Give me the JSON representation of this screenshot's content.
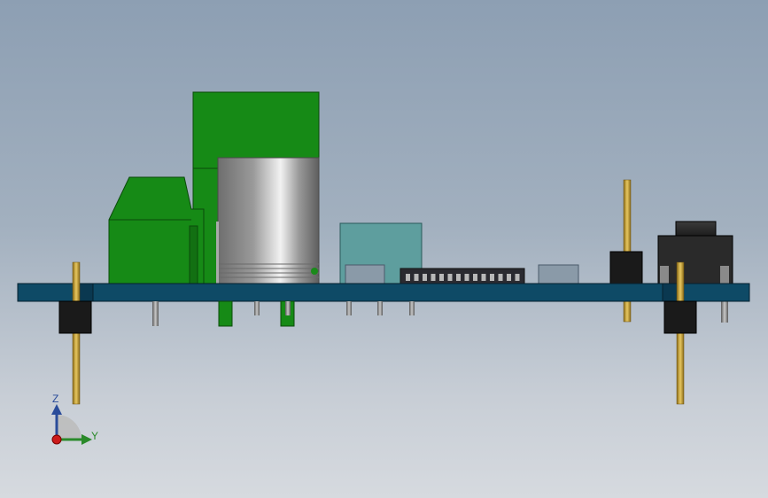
{
  "viewport": {
    "background_top": "#8d9fb3",
    "background_bottom": "#d6dadf"
  },
  "model": {
    "pcb_color": "#0e4a66",
    "terminal_block_color": "#1a8a1a",
    "capacitor_color": "#9a9a9a",
    "module_color": "#5a9a9a",
    "header_pin_color": "#c8a030",
    "pushbutton_color": "#2a2a2a"
  },
  "triad": {
    "z_label": "Z",
    "y_label": "Y",
    "z_color": "#2a4c9a",
    "y_color": "#2a8a2a",
    "origin_color": "#cc1a1a"
  }
}
